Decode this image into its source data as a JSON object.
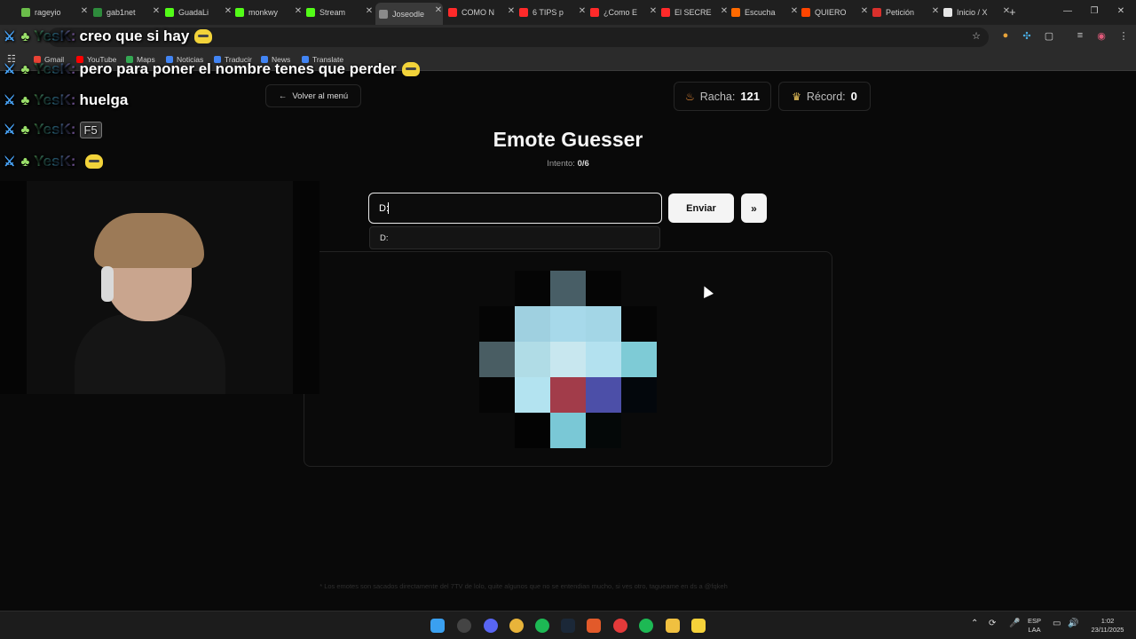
{
  "browser": {
    "tabs": [
      {
        "label": "rageyio",
        "color": "#6bbd4a"
      },
      {
        "label": "gab1net",
        "color": "#2e8b3c"
      },
      {
        "label": "GuadaLi",
        "color": "#53fc18"
      },
      {
        "label": "monkwy",
        "color": "#53fc18"
      },
      {
        "label": "Stream",
        "color": "#53fc18"
      },
      {
        "label": "Joseodle",
        "color": "#8a8a8a"
      },
      {
        "label": "COMO N",
        "color": "#ff2a2a"
      },
      {
        "label": "6 TIPS p",
        "color": "#ff2a2a"
      },
      {
        "label": "¿Como E",
        "color": "#ff2a2a"
      },
      {
        "label": "El SECRE",
        "color": "#ff2a2a"
      },
      {
        "label": "Escucha",
        "color": "#ff6a00"
      },
      {
        "label": "QUIERO",
        "color": "#ff4500"
      },
      {
        "label": "Petición",
        "color": "#d9302c"
      },
      {
        "label": "Inicio / X",
        "color": "#e6e6e6"
      }
    ],
    "active_tab_index": 5,
    "bookmarks": [
      {
        "label": "Gmail",
        "color": "#ea4335"
      },
      {
        "label": "YouTube",
        "color": "#ff0000"
      },
      {
        "label": "Maps",
        "color": "#34a853"
      },
      {
        "label": "Noticias",
        "color": "#4285f4"
      },
      {
        "label": "Traducir",
        "color": "#4285f4"
      },
      {
        "label": "News",
        "color": "#4285f4"
      },
      {
        "label": "Translate",
        "color": "#4285f4"
      }
    ]
  },
  "page": {
    "back_label": "Volver al menú",
    "streak_label": "Racha:",
    "streak_value": "121",
    "record_label": "Récord:",
    "record_value": "0",
    "title": "Emote Guesser",
    "attempt_label": "Intento:",
    "attempt_value": "0/6",
    "guess_value": "D:",
    "send_label": "Enviar",
    "skip_label": "»",
    "suggestion": "D:",
    "footnote": "* Los emotes son sacados directamente del 7TV de lolo, quite algunos que no se entendian mucho, si ves otro, tagueame en ds a @fqkeh",
    "emote_pixels": [
      {
        "col": 1,
        "row": 0,
        "color": "#050505"
      },
      {
        "col": 2,
        "row": 0,
        "color": "#485e66"
      },
      {
        "col": 3,
        "row": 0,
        "color": "#050505"
      },
      {
        "col": 0,
        "row": 1,
        "color": "#050505"
      },
      {
        "col": 1,
        "row": 1,
        "color": "#9fd0e0"
      },
      {
        "col": 2,
        "row": 1,
        "color": "#a7d9ea"
      },
      {
        "col": 3,
        "row": 1,
        "color": "#a3d6e6"
      },
      {
        "col": 4,
        "row": 1,
        "color": "#050505"
      },
      {
        "col": 0,
        "row": 2,
        "color": "#495d63"
      },
      {
        "col": 1,
        "row": 2,
        "color": "#b0dce6"
      },
      {
        "col": 2,
        "row": 2,
        "color": "#c8e7ef"
      },
      {
        "col": 3,
        "row": 2,
        "color": "#b3e1ef"
      },
      {
        "col": 4,
        "row": 2,
        "color": "#7ecbd6"
      },
      {
        "col": 0,
        "row": 3,
        "color": "#050505"
      },
      {
        "col": 1,
        "row": 3,
        "color": "#b3e3f0"
      },
      {
        "col": 2,
        "row": 3,
        "color": "#a23c4a"
      },
      {
        "col": 3,
        "row": 3,
        "color": "#4c4fa8"
      },
      {
        "col": 4,
        "row": 3,
        "color": "#03070c"
      },
      {
        "col": 1,
        "row": 4,
        "color": "#030303"
      },
      {
        "col": 2,
        "row": 4,
        "color": "#7ac8d6"
      },
      {
        "col": 3,
        "row": 4,
        "color": "#040808"
      }
    ]
  },
  "overlay": {
    "chat": [
      {
        "user": "YesK:",
        "text": "creo que si hay",
        "emote": true
      },
      {
        "user": "YesK:",
        "text": "pero para poner el nombre tenes que perder",
        "emote": true
      },
      {
        "user": "YesK:",
        "text": "huelga",
        "emote": false
      },
      {
        "user": "YesK:",
        "text": "",
        "keycap": "F5",
        "emote": false
      },
      {
        "user": "YesK:",
        "text": "",
        "emote": true
      }
    ]
  },
  "taskbar": {
    "language_line1": "ESP",
    "language_line2": "LAA",
    "time": "1:02",
    "date": "23/11/2025"
  }
}
